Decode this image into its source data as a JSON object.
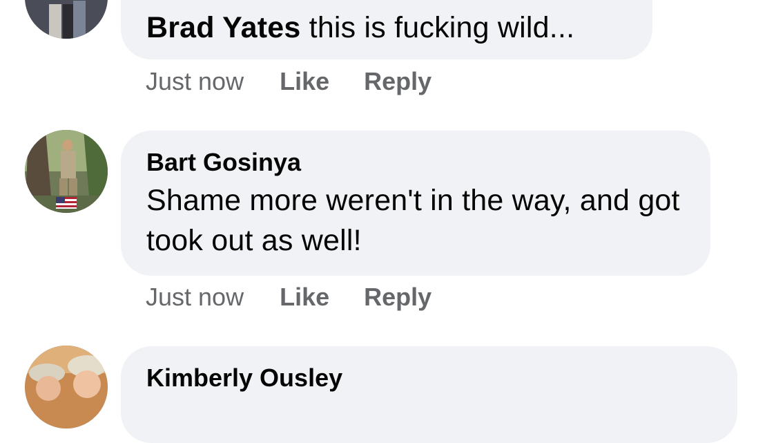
{
  "comments": [
    {
      "author": "Brad Yates",
      "text": "this is fucking wild...",
      "timestamp": "Just now",
      "like_label": "Like",
      "reply_label": "Reply"
    },
    {
      "author": "Bart Gosinya",
      "text": "Shame more weren't in the way, and got took out as well!",
      "timestamp": "Just now",
      "like_label": "Like",
      "reply_label": "Reply"
    },
    {
      "author": "Kimberly Ousley"
    }
  ],
  "colors": {
    "bubble_bg": "#f0f2f5",
    "text_primary": "#050505",
    "text_secondary": "#65676b",
    "page_bg": "#ffffff"
  }
}
